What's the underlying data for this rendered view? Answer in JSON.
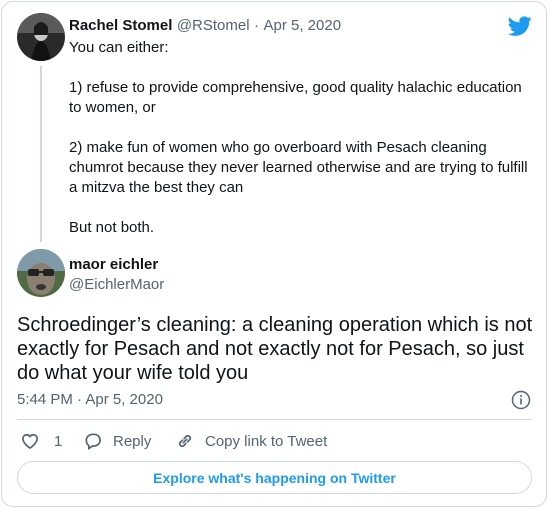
{
  "quoted_tweet": {
    "author_name": "Rachel Stomel",
    "author_handle": "@RStomel",
    "separator": "·",
    "date": "Apr 5, 2020",
    "lines": [
      "You can either:",
      "1) refuse to provide comprehensive, good quality halachic education",
      "to women, or",
      "2) make fun of women who go overboard with Pesach cleaning",
      "chumrot because they never learned otherwise and are trying to fulfill",
      "a mitzva the best they can",
      "But not both."
    ]
  },
  "main_tweet": {
    "author_name": "maor eichler",
    "author_handle": "@EichlerMaor",
    "lines": [
      "Schroedinger’s cleaning: a cleaning operation which is not",
      "exactly for Pesach and not exactly not for Pesach, so just",
      "do what your wife told you"
    ],
    "timestamp": "5:44 PM · Apr 5, 2020"
  },
  "actions": {
    "like_count": "1",
    "reply_label": "Reply",
    "copy_link_label": "Copy link to Tweet"
  },
  "explore_button_label": "Explore what's happening on Twitter",
  "icons": {
    "brand": "twitter-bird-icon",
    "info": "info-icon",
    "like": "heart-icon",
    "reply": "reply-bubble-icon",
    "copy": "link-icon"
  },
  "colors": {
    "twitter_blue": "#1d9bf0",
    "muted_text": "#536471",
    "border": "#cfd9de"
  }
}
